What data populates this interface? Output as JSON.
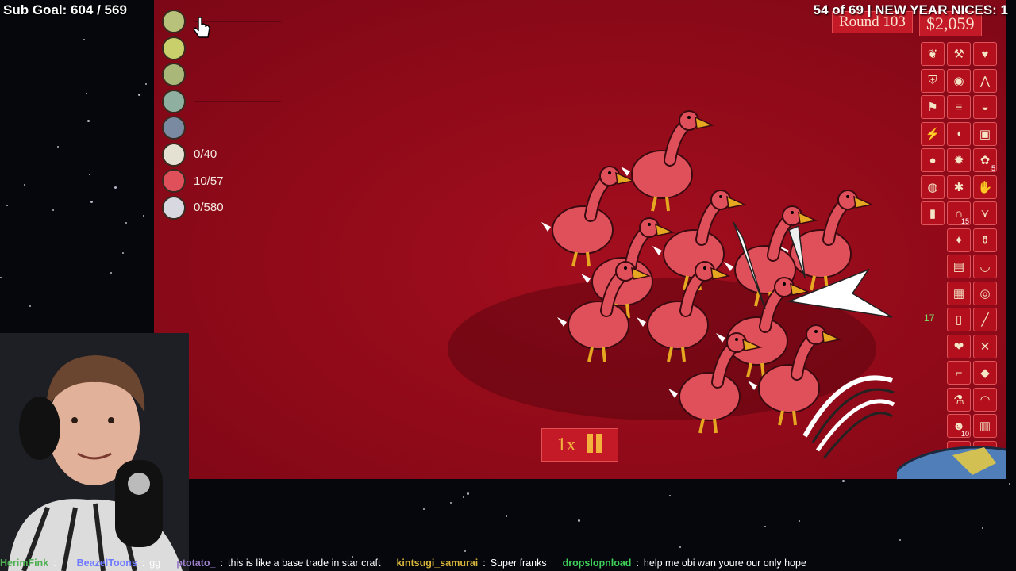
{
  "stream_overlay": {
    "sub_goal": "Sub Goal: 604 / 569",
    "status": "54 of 69 | NEW YEAR NICES: 1"
  },
  "hud": {
    "round": "Round 103",
    "money": "$2,059",
    "speed": "1x",
    "speed_button_icon": "pause-icon",
    "side_count": "17"
  },
  "enemy_tracker": [
    {
      "icon": "frankenstein-icon",
      "count": ""
    },
    {
      "icon": "green-head-icon",
      "count": ""
    },
    {
      "icon": "capped-zombie-icon",
      "count": ""
    },
    {
      "icon": "ghoul-icon",
      "count": ""
    },
    {
      "icon": "hooded-enemy-icon",
      "count": ""
    },
    {
      "icon": "skull-icon",
      "count": "0/40"
    },
    {
      "icon": "red-bird-icon",
      "count": "10/57"
    },
    {
      "icon": "penguin-icon",
      "count": "0/580"
    }
  ],
  "items": [
    {
      "icon": "feather-icon"
    },
    {
      "icon": "axe-icon"
    },
    {
      "icon": "heart-organ-icon"
    },
    {
      "icon": "shield-icon"
    },
    {
      "icon": "meat-icon"
    },
    {
      "icon": "fangs-icon"
    },
    {
      "icon": "runner-icon"
    },
    {
      "icon": "scroll-icon"
    },
    {
      "icon": "taco-icon"
    },
    {
      "icon": "lightning-icon"
    },
    {
      "icon": "bread-icon"
    },
    {
      "icon": "jar-icon"
    },
    {
      "icon": "tomato-icon"
    },
    {
      "icon": "fire-icon"
    },
    {
      "icon": "plant-icon",
      "count": "5"
    },
    {
      "icon": "brain-icon"
    },
    {
      "icon": "spider-icon"
    },
    {
      "icon": "glove-icon"
    },
    {
      "icon": "pill-icon"
    },
    {
      "icon": "tombstone-icon",
      "count": "15"
    },
    {
      "icon": "claw-icon"
    },
    {
      "icon": "bug-icon"
    },
    {
      "icon": "potion-icon"
    },
    {
      "icon": "book-icon"
    },
    {
      "icon": "cauldron-icon"
    },
    {
      "icon": "map-icon"
    },
    {
      "icon": "eyeball-icon"
    },
    {
      "icon": "paper-icon"
    },
    {
      "icon": "blade-icon"
    },
    {
      "icon": "heart-icon"
    },
    {
      "icon": "crossbones-icon"
    },
    {
      "icon": "leg-icon"
    },
    {
      "icon": "stone-icon"
    },
    {
      "icon": "flask-icon"
    },
    {
      "icon": "helmet-icon"
    },
    {
      "icon": "head-icon",
      "count": "10"
    },
    {
      "icon": "train-icon"
    },
    {
      "icon": "sword-icon"
    },
    {
      "icon": "tent-icon"
    }
  ],
  "chat": [
    {
      "user": "HerimFink",
      "color": "#4caf50",
      "message": ""
    },
    {
      "user": "BeazelToons",
      "color": "#6f7bff",
      "message": "gg"
    },
    {
      "user": "ptotato_",
      "color": "#9c7ec9",
      "message": "this is like a base trade in star craft"
    },
    {
      "user": "kintsugi_samurai",
      "color": "#d6b43a",
      "message": "Super franks"
    },
    {
      "user": "dropslopnload",
      "color": "#3fd15a",
      "message": "help me obi wan  youre our only hope"
    }
  ],
  "colors": {
    "game_bg": "#8f0a19",
    "panel_red": "#c41a27",
    "accent_gold": "#f2b23c",
    "duck_body": "#e0505a",
    "duck_beak": "#e5a820"
  }
}
